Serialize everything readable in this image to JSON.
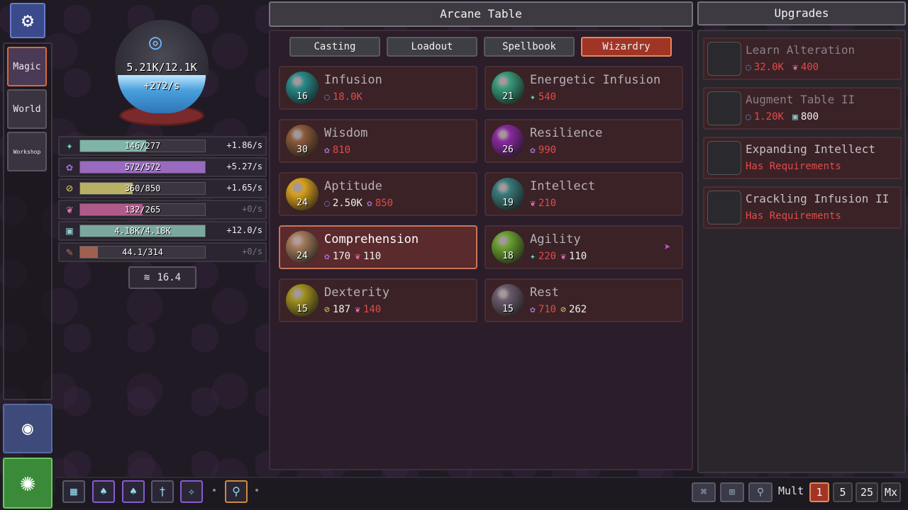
{
  "left_nav": {
    "settings_icon": "gear-icon",
    "tiles": [
      {
        "label": "Magic",
        "active": true
      },
      {
        "label": "World",
        "active": false
      },
      {
        "label": "Workshop",
        "active": false
      }
    ],
    "discord_icon": "discord-icon",
    "hero_icon": "person-icon"
  },
  "orb": {
    "value": "5.21K/12.1K",
    "rate": "+272/s"
  },
  "resources": [
    {
      "icon": "star-icon",
      "value": "146/277",
      "rate": "+1.86/s",
      "fill": 0.53,
      "color": "#7fb5a8"
    },
    {
      "icon": "lotus-icon",
      "value": "572/572",
      "rate": "+5.27/s",
      "fill": 1.0,
      "color": "#9a6ac0"
    },
    {
      "icon": "coin-icon",
      "value": "360/850",
      "rate": "+1.65/s",
      "fill": 0.42,
      "color": "#b8b064"
    },
    {
      "icon": "heart-icon",
      "value": "132/265",
      "rate": "+0/s",
      "fill": 0.5,
      "color": "#b05a8a"
    },
    {
      "icon": "cube-icon",
      "value": "4.18K/4.18K",
      "rate": "+12.0/s",
      "fill": 1.0,
      "color": "#7aa8a0"
    },
    {
      "icon": "scroll-icon",
      "value": "44.1/314",
      "rate": "+0/s",
      "fill": 0.14,
      "color": "#a06050"
    }
  ],
  "multiplier_box": {
    "value": "16.4"
  },
  "main": {
    "title": "Arcane Table",
    "tabs": [
      {
        "label": "Casting",
        "active": false
      },
      {
        "label": "Loadout",
        "active": false
      },
      {
        "label": "Spellbook",
        "active": false
      },
      {
        "label": "Wizardry",
        "active": true
      }
    ],
    "skills": [
      {
        "name": "Infusion",
        "level": "16",
        "orb": "#2a8a8a",
        "costs": [
          {
            "icon": "swirl-icon",
            "glyph": "◌",
            "value": "18.0K",
            "state": "red"
          }
        ]
      },
      {
        "name": "Energetic Infusion",
        "level": "21",
        "orb": "#3a9a7a",
        "costs": [
          {
            "icon": "star-icon",
            "glyph": "✦",
            "value": "540",
            "state": "red"
          }
        ]
      },
      {
        "name": "Wisdom",
        "level": "30",
        "orb": "#8a5a3a",
        "costs": [
          {
            "icon": "lotus-icon",
            "glyph": "✿",
            "value": "810",
            "state": "red"
          }
        ]
      },
      {
        "name": "Resilience",
        "level": "26",
        "orb": "#8a2aa0",
        "costs": [
          {
            "icon": "lotus-icon",
            "glyph": "✿",
            "value": "990",
            "state": "red"
          }
        ]
      },
      {
        "name": "Aptitude",
        "level": "24",
        "orb": "#d8a020",
        "costs": [
          {
            "icon": "swirl-icon",
            "glyph": "◌",
            "value": "2.50K",
            "state": "ok"
          },
          {
            "icon": "lotus-icon",
            "glyph": "✿",
            "value": "850",
            "state": "red"
          }
        ]
      },
      {
        "name": "Intellect",
        "level": "19",
        "orb": "#3a7a7a",
        "costs": [
          {
            "icon": "heart-icon",
            "glyph": "❦",
            "value": "210",
            "state": "red"
          }
        ]
      },
      {
        "name": "Comprehension",
        "level": "24",
        "orb": "#a07a5a",
        "selected": true,
        "costs": [
          {
            "icon": "lotus-icon",
            "glyph": "✿",
            "value": "170",
            "state": "ok"
          },
          {
            "icon": "heart-icon",
            "glyph": "❦",
            "value": "110",
            "state": "ok"
          }
        ]
      },
      {
        "name": "Agility",
        "level": "18",
        "orb": "#6aa030",
        "costs": [
          {
            "icon": "star-icon",
            "glyph": "✦",
            "value": "220",
            "state": "red"
          },
          {
            "icon": "heart-icon",
            "glyph": "❦",
            "value": "110",
            "state": "ok"
          }
        ]
      },
      {
        "name": "Dexterity",
        "level": "15",
        "orb": "#a09020",
        "costs": [
          {
            "icon": "coin-icon",
            "glyph": "⊘",
            "value": "187",
            "state": "ok"
          },
          {
            "icon": "heart-icon",
            "glyph": "❦",
            "value": "140",
            "state": "red"
          }
        ]
      },
      {
        "name": "Rest",
        "level": "15",
        "orb": "#6a5a6a",
        "costs": [
          {
            "icon": "lotus-icon",
            "glyph": "✿",
            "value": "710",
            "state": "red"
          },
          {
            "icon": "coin-icon",
            "glyph": "⊘",
            "value": "262",
            "state": "ok"
          }
        ]
      }
    ]
  },
  "upgrades": {
    "title": "Upgrades",
    "items": [
      {
        "name": "Learn Alteration",
        "bright": false,
        "icon": "alteration-icon",
        "costs": [
          {
            "icon": "swirl-icon",
            "glyph": "◌",
            "value": "32.0K",
            "state": "red"
          },
          {
            "icon": "heart-icon",
            "glyph": "❦",
            "value": "400",
            "state": "red"
          }
        ]
      },
      {
        "name": "Augment Table II",
        "bright": false,
        "icon": "rune-tablet-icon",
        "costs": [
          {
            "icon": "swirl-icon",
            "glyph": "◌",
            "value": "1.20K",
            "state": "red"
          },
          {
            "icon": "cube-icon",
            "glyph": "▣",
            "value": "800",
            "state": "ok"
          }
        ]
      },
      {
        "name": "Expanding Intellect",
        "bright": true,
        "icon": "brain-orb-icon",
        "requirement": "Has Requirements"
      },
      {
        "name": "Crackling Infusion II",
        "bright": true,
        "icon": "storm-orb-icon",
        "requirement": "Has Requirements"
      }
    ]
  },
  "bottom_bar": {
    "hotbar_icons": [
      "spell-slot-icon",
      "mushroom-icon",
      "mushroom-icon",
      "sword-icon",
      "spark-icon",
      "magnifier-icon"
    ],
    "right_buttons": [
      "gamepad-icon",
      "table-icon",
      "search-icon"
    ],
    "mult_label": "Mult",
    "mult_options": [
      {
        "label": "1",
        "active": true
      },
      {
        "label": "5",
        "active": false
      },
      {
        "label": "25",
        "active": false
      },
      {
        "label": "Mx",
        "active": false
      }
    ]
  }
}
